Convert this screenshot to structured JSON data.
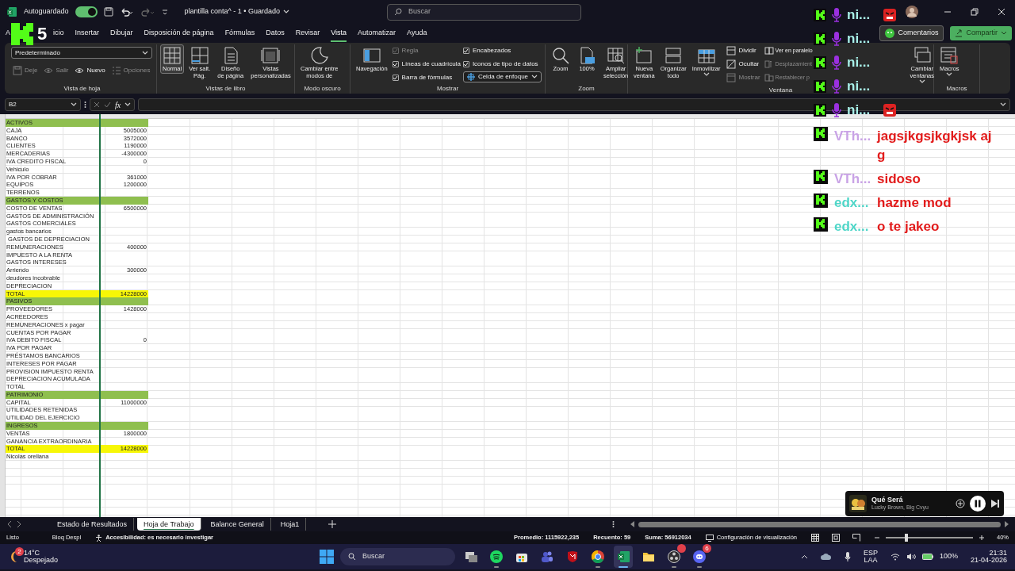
{
  "title_bar": {
    "autosave_label": "Autoguardado",
    "autosave_on": true,
    "doc_title": "plantilla conta^ - 1 • Guardado",
    "search_placeholder": "Buscar"
  },
  "menu_tabs": [
    {
      "label": "A",
      "selected": false
    },
    {
      "label": "icio",
      "selected": false
    },
    {
      "label": "Insertar",
      "selected": false
    },
    {
      "label": "Dibujar",
      "selected": false
    },
    {
      "label": "Disposición de página",
      "selected": false
    },
    {
      "label": "Fórmulas",
      "selected": false
    },
    {
      "label": "Datos",
      "selected": false
    },
    {
      "label": "Revisar",
      "selected": false
    },
    {
      "label": "Vista",
      "selected": true
    },
    {
      "label": "Automatizar",
      "selected": false
    },
    {
      "label": "Ayuda",
      "selected": false
    }
  ],
  "top_buttons": {
    "comments": "Comentarios",
    "share": "Compartir"
  },
  "ribbon": [
    {
      "title": "Vista de hoja",
      "stacks": [
        [
          {
            "kind": "select",
            "value": "Predeterminado"
          },
          {
            "kind": "row",
            "items": [
              {
                "kind": "small",
                "label": "Deje",
                "disabled": true
              },
              {
                "kind": "small",
                "label": "Salir",
                "disabled": true
              },
              {
                "kind": "small",
                "label": "Nuevo",
                "disabled": false
              },
              {
                "kind": "small",
                "label": "Opciones",
                "disabled": true
              }
            ]
          }
        ]
      ]
    },
    {
      "title": "Vistas de libro",
      "stacks": [
        [
          {
            "kind": "large",
            "label": "Normal",
            "selected": true
          }
        ],
        [
          {
            "kind": "large",
            "label": "Ver salt.\nPág.",
            "selected": false
          }
        ],
        [
          {
            "kind": "large",
            "label": "Diseño\nde página",
            "selected": false
          }
        ],
        [
          {
            "kind": "large",
            "label": "Vistas\npersonalizadas",
            "selected": false
          }
        ]
      ]
    },
    {
      "title": "Modo oscuro",
      "stacks": [
        [
          {
            "kind": "large",
            "label": "Cambiar entre\nmodos de",
            "selected": false
          }
        ]
      ]
    },
    {
      "title": "Mostrar",
      "stacks": [
        [
          {
            "kind": "large",
            "label": "Navegación",
            "selected": false
          }
        ],
        [
          {
            "kind": "check",
            "label": "Regla",
            "checked": true,
            "disabled": true
          },
          {
            "kind": "check",
            "label": "Líneas de cuadrícula",
            "checked": true,
            "disabled": false
          },
          {
            "kind": "check",
            "label": "Barra de fórmulas",
            "checked": true,
            "disabled": false
          }
        ],
        [
          {
            "kind": "check",
            "label": "Encabezados",
            "checked": true,
            "disabled": false
          },
          {
            "kind": "check",
            "label": "Iconos de tipo de datos",
            "checked": true,
            "disabled": false
          },
          {
            "kind": "split",
            "label": "Celda de enfoque"
          }
        ]
      ]
    },
    {
      "title": "Zoom",
      "stacks": [
        [
          {
            "kind": "large",
            "label": "Zoom",
            "selected": false
          }
        ],
        [
          {
            "kind": "large",
            "label": "100%",
            "selected": false
          }
        ],
        [
          {
            "kind": "large",
            "label": "Ampliar\nselección",
            "selected": false
          }
        ]
      ]
    },
    {
      "title": "Ventana",
      "stacks": [
        [
          {
            "kind": "large",
            "label": "Nueva\nventana",
            "selected": false
          }
        ],
        [
          {
            "kind": "large",
            "label": "Organizar\ntodo",
            "selected": false
          }
        ],
        [
          {
            "kind": "large",
            "label": "Inmovilizar",
            "selected": false,
            "caret": true
          }
        ],
        [
          {
            "kind": "small",
            "label": "Dividir",
            "disabled": false
          },
          {
            "kind": "small",
            "label": "Ocultar",
            "disabled": false
          },
          {
            "kind": "small",
            "label": "Mostrar",
            "disabled": true
          }
        ],
        [
          {
            "kind": "small",
            "label": "Ver en paralelo",
            "disabled": false
          },
          {
            "kind": "small",
            "label": "Desplazamient",
            "disabled": true
          },
          {
            "kind": "small",
            "label": "Restablecer p",
            "disabled": true
          }
        ],
        [
          {
            "kind": "large",
            "label": "Cambiar\nventanas",
            "selected": false,
            "caret": true
          }
        ]
      ]
    },
    {
      "title": "Macros",
      "stacks": [
        [
          {
            "kind": "large",
            "label": "Macros",
            "selected": false,
            "caret": true
          }
        ]
      ]
    }
  ],
  "formula_bar": {
    "name_box": "B2",
    "function_label": "fx"
  },
  "sheet": {
    "rows": [
      {
        "label": "ACTIVOS",
        "kind": "header"
      },
      {
        "label": "CAJA",
        "value": "5005000",
        "kind": "normal"
      },
      {
        "label": "BANCO",
        "value": "3572000",
        "kind": "normal"
      },
      {
        "label": "CLIENTES",
        "value": "1190000",
        "kind": "normal"
      },
      {
        "label": "MERCADERIAS",
        "value": "-4300000",
        "kind": "normal"
      },
      {
        "label": "IVA CREDITO FISCAL",
        "value": "0",
        "kind": "normal"
      },
      {
        "label": "Vehiculo",
        "kind": "normal"
      },
      {
        "label": "IVA POR COBRAR",
        "value": "361000",
        "kind": "normal"
      },
      {
        "label": "EQUIPOS",
        "value": "1200000",
        "kind": "normal"
      },
      {
        "label": "TERRENOS",
        "kind": "normal"
      },
      {
        "label": "GASTOS Y COSTOS",
        "kind": "header"
      },
      {
        "label": "COSTO DE VENTAS",
        "value": "6500000",
        "kind": "normal"
      },
      {
        "label": "GASTOS DE ADMINISTRACIÓN",
        "kind": "normal"
      },
      {
        "label": "GASTOS COMERCIALES",
        "kind": "normal"
      },
      {
        "label": "gastos bancarios",
        "kind": "normal"
      },
      {
        "label": " GASTOS DE DEPRECIACION",
        "kind": "normal"
      },
      {
        "label": "REMUNERACIONES",
        "value": "400000",
        "kind": "normal"
      },
      {
        "label": "IMPUESTO A LA RENTA",
        "kind": "normal"
      },
      {
        "label": "GASTOS INTERESES",
        "kind": "normal"
      },
      {
        "label": "Arriendo",
        "value": "300000",
        "kind": "normal"
      },
      {
        "label": "deudores incobrable",
        "kind": "normal"
      },
      {
        "label": "DEPRECIACION",
        "kind": "normal"
      },
      {
        "label": "TOTAL",
        "value": "14228000",
        "kind": "total"
      },
      {
        "label": "PASIVOS",
        "kind": "header"
      },
      {
        "label": "PROVEEDORES",
        "value": "1428000",
        "kind": "normal"
      },
      {
        "label": "ACREEDORES",
        "kind": "normal"
      },
      {
        "label": "REMUNERACIONES x pagar",
        "kind": "normal"
      },
      {
        "label": "CUENTAS POR PAGAR",
        "kind": "normal"
      },
      {
        "label": "IVA DEBITO FISCAL",
        "value": "0",
        "kind": "normal"
      },
      {
        "label": "IVA POR PAGAR",
        "kind": "normal"
      },
      {
        "label": "PRÉSTAMOS BANCARIOS",
        "kind": "normal"
      },
      {
        "label": "INTERESES POR PAGAR",
        "kind": "normal"
      },
      {
        "label": "PROVISION IMPUESTO RENTA",
        "kind": "normal"
      },
      {
        "label": "DEPRECIACION ACUMULADA",
        "kind": "normal"
      },
      {
        "label": "TOTAL",
        "kind": "normal"
      },
      {
        "label": "PATRIMONIO",
        "kind": "header"
      },
      {
        "label": "CAPITAL",
        "value": "11000000",
        "kind": "normal"
      },
      {
        "label": "UTILIDADES RETENIDAS",
        "kind": "normal"
      },
      {
        "label": "UTILIDAD DEL EJERCICIO",
        "kind": "normal"
      },
      {
        "label": "INGRESOS",
        "kind": "header"
      },
      {
        "label": "VENTAS",
        "value": "1800000",
        "kind": "normal"
      },
      {
        "label": "GANANCIA EXTRAORDINARIA",
        "kind": "normal"
      },
      {
        "label": "TOTAL",
        "value": "14228000",
        "kind": "total"
      },
      {
        "label": "Nicolas orellana",
        "kind": "normal"
      }
    ]
  },
  "sheet_tabs": [
    {
      "label": "Estado de Resultados",
      "selected": false
    },
    {
      "label": "Hoja de Trabajo",
      "selected": true
    },
    {
      "label": "Balance General",
      "selected": false
    },
    {
      "label": "Hoja1",
      "selected": false
    }
  ],
  "status_bar": {
    "ready": "Listo",
    "scroll_lock": "Bloq Despl",
    "accessibility": "Accesibilidad: es necesario investigar",
    "average": "Promedio: 1115922,235",
    "count": "Recuento: 59",
    "sum": "Suma: 56912034",
    "display_settings": "Configuración de visualización",
    "zoom": {
      "level": 0.24,
      "reading": "40%"
    }
  },
  "media_player": {
    "title": "Qué Será",
    "artist": "Lucky Brown, Big Cvyu"
  },
  "overlay": {
    "viewer_count": "5",
    "voice_rows": [
      {
        "user": "ni...",
        "emote": true
      },
      {
        "user": "ni...",
        "emote": false
      },
      {
        "user": "ni...",
        "emote": false
      },
      {
        "user": "ni...",
        "emote": false
      },
      {
        "user": "ni...",
        "emote": true
      }
    ],
    "messages": [
      {
        "user": "VTh...",
        "color": "#c9a3e6",
        "text": "jagsjkgsjkgkjsk ajg"
      },
      {
        "user": "VTh...",
        "color": "#c9a3e6",
        "text": "sidoso"
      },
      {
        "user": "edx...",
        "color": "#4fd6c8",
        "text": "hazme mod"
      },
      {
        "user": "edx...",
        "color": "#4fd6c8",
        "text": "o te jakeo"
      }
    ]
  },
  "taskbar": {
    "weather": {
      "badge": "2",
      "temp": "14°C",
      "condition": "Despejado"
    },
    "search_placeholder": "Buscar",
    "apps": [
      {
        "running": false,
        "selected": false
      },
      {
        "running": true,
        "selected": false
      },
      {
        "running": false,
        "selected": false
      },
      {
        "running": false,
        "selected": false
      },
      {
        "running": false,
        "selected": false
      },
      {
        "running": true,
        "selected": false
      },
      {
        "running": true,
        "selected": true
      },
      {
        "running": false,
        "selected": false
      },
      {
        "running": true,
        "selected": false,
        "dot": true
      },
      {
        "running": true,
        "selected": false,
        "badge": "6"
      }
    ],
    "tray": {
      "language": "ESP",
      "layout": "LAA",
      "battery": "100%",
      "time": "21:31",
      "date": "21-04-2026"
    }
  }
}
